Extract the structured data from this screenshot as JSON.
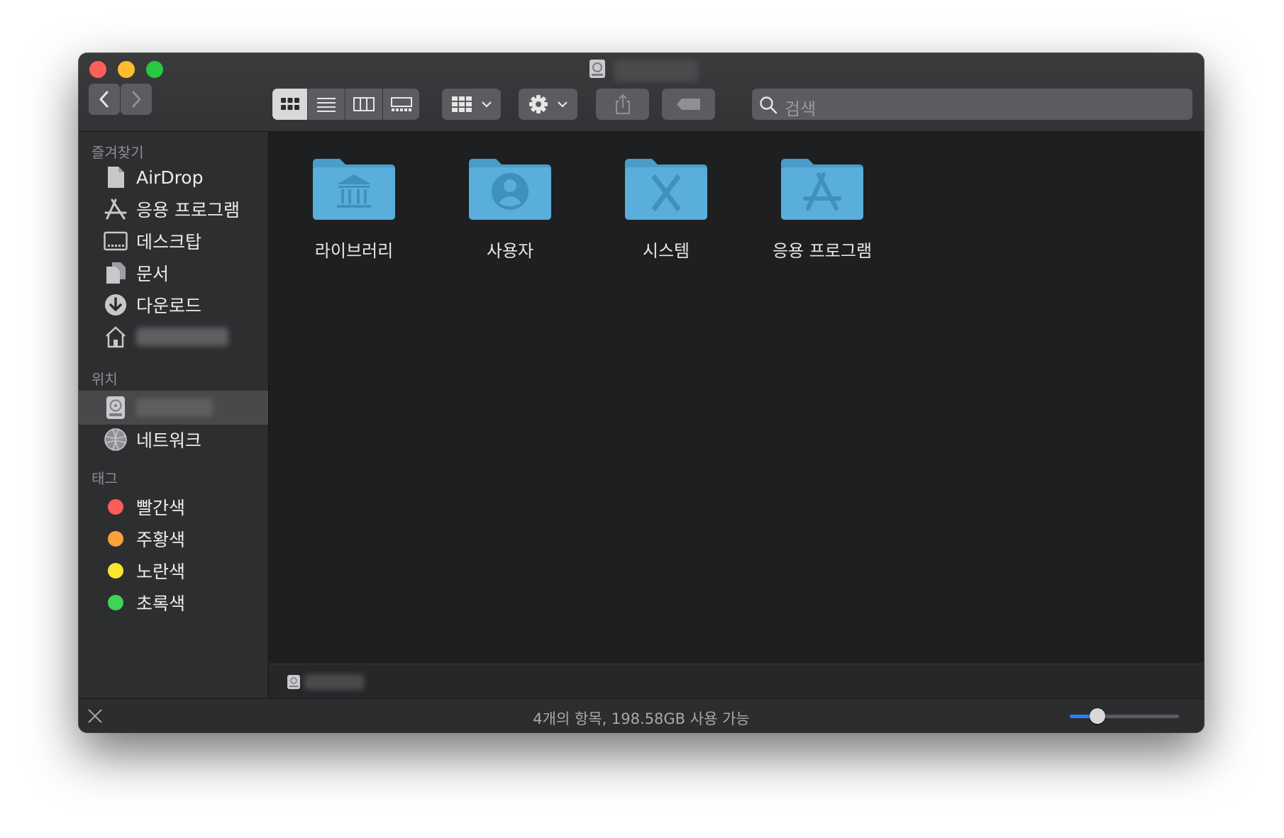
{
  "toolbar": {
    "search_placeholder": "검색"
  },
  "sidebar": {
    "favorites_title": "즐겨찾기",
    "favorites": [
      {
        "label": "AirDrop",
        "icon": "airdrop-icon"
      },
      {
        "label": "응용 프로그램",
        "icon": "applications-icon"
      },
      {
        "label": "데스크탑",
        "icon": "desktop-icon"
      },
      {
        "label": "문서",
        "icon": "documents-icon"
      },
      {
        "label": "다운로드",
        "icon": "downloads-icon"
      },
      {
        "label": "",
        "icon": "home-icon"
      }
    ],
    "locations_title": "위치",
    "locations": [
      {
        "label": "",
        "icon": "hard-drive-icon"
      },
      {
        "label": "네트워크",
        "icon": "network-icon"
      }
    ],
    "tags_title": "태그",
    "tags": [
      {
        "label": "빨간색",
        "color": "#fe5c58"
      },
      {
        "label": "주황색",
        "color": "#fda13b"
      },
      {
        "label": "노란색",
        "color": "#fde42f"
      },
      {
        "label": "초록색",
        "color": "#41d354"
      }
    ]
  },
  "content": {
    "items": [
      {
        "label": "라이브러리",
        "icon": "library-folder-icon"
      },
      {
        "label": "사용자",
        "icon": "users-folder-icon"
      },
      {
        "label": "시스템",
        "icon": "system-folder-icon"
      },
      {
        "label": "응용 프로그램",
        "icon": "applications-folder-icon"
      }
    ]
  },
  "status": {
    "text": "4개의 항목, 198.58GB 사용 가능",
    "icon_size_level": 0.25
  },
  "colors": {
    "folder": "#5aaedb",
    "folder_tab": "#4c9cc9",
    "accent": "#2e7cf6"
  }
}
